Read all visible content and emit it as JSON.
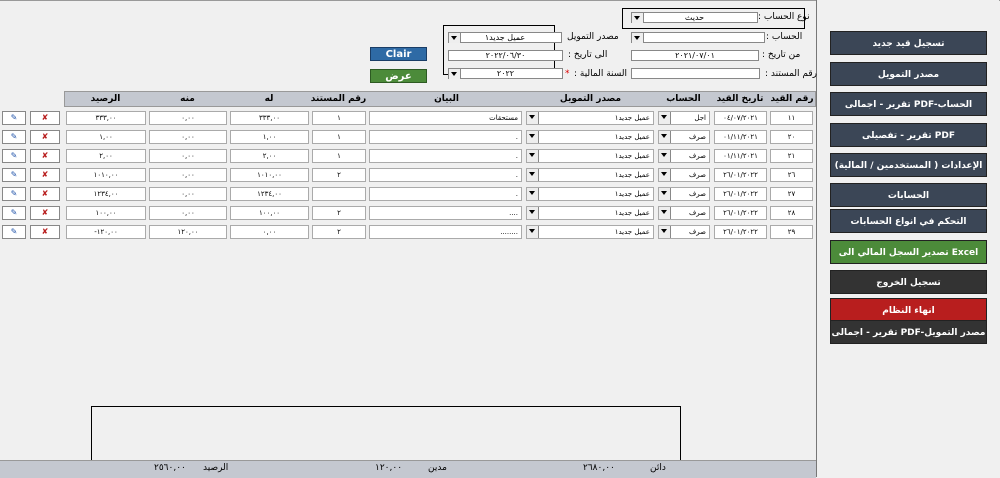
{
  "sidebar": {
    "items": [
      {
        "label": "تسجيل قيد جديد",
        "style": "normal"
      },
      {
        "label": "مصدر التمويل",
        "style": "normal"
      },
      {
        "label": "تقرير - اجمالى PDF-الحساب",
        "style": "normal"
      },
      {
        "label": "تقرير - تفصيلى PDF",
        "style": "normal"
      },
      {
        "label": "الإعدادات ( المستخدمين / المالية)",
        "style": "normal"
      },
      {
        "label": "الحسابات",
        "style": "normal"
      },
      {
        "label": "التحكم في انواع الحسابات",
        "style": "normal"
      },
      {
        "label": "تصدير السجل المالي الى Excel",
        "style": "green"
      },
      {
        "label": "تسجيل الخروج",
        "style": "dark"
      },
      {
        "label": "انهاء النظام",
        "style": "red"
      },
      {
        "label": "تقرير - اجمالى PDF-مصدر التمويل",
        "style": "dark"
      }
    ]
  },
  "form": {
    "account_type_label": "نوع الحساب :",
    "account_type_value": "حديث",
    "account_label": "الحساب :",
    "account_value": "",
    "funding_source_label": "مصدر التمويل",
    "funding_source_value": "عميل جديد١",
    "from_date_label": "من تاريخ :",
    "from_date_value": "٢٠٢١/٠٧/٠١",
    "to_date_label": "الى تاريخ :",
    "to_date_value": "٢٠٢٢/٠٦/٣٠",
    "doc_no_label": "رقم المستند :",
    "doc_no_value": "",
    "fiscal_year_label": "السنة المالية :",
    "fiscal_year_required": "*",
    "fiscal_year_value": "٢٠٢٢",
    "clear_button": "Clair",
    "show_button": "عرض"
  },
  "table": {
    "headers": {
      "entry_no": "رقم القيد",
      "entry_date": "تاريخ القيد",
      "account": "الحساب",
      "funding_source": "مصدر التمويل",
      "statement": "البيان",
      "doc_no": "رقم المستند",
      "credit": "له",
      "debit": "منه",
      "balance": "الرصيد"
    },
    "rows": [
      {
        "entry_no": "١١",
        "date": "٠٤/٠٧/٢٠٢١",
        "account": "اجل",
        "source": "عميل جديد١",
        "statement": "مستحقات",
        "doc_no": "١",
        "credit": "٣٣٣,٠٠",
        "debit": "٠,٠٠",
        "balance": "٣٣٣,٠٠"
      },
      {
        "entry_no": "٢٠",
        "date": "٠١/١١/٢٠٢١",
        "account": "صرف",
        "source": "عميل جديد١",
        "statement": ".",
        "doc_no": "١",
        "credit": "١,٠٠",
        "debit": "٠,٠٠",
        "balance": "١,٠٠"
      },
      {
        "entry_no": "٢١",
        "date": "٠١/١١/٢٠٢١",
        "account": "صرف",
        "source": "عميل جديد١",
        "statement": ".",
        "doc_no": "١",
        "credit": "٢,٠٠",
        "debit": "٠,٠٠",
        "balance": "٢,٠٠"
      },
      {
        "entry_no": "٢٦",
        "date": "٢٦/٠١/٢٠٢٢",
        "account": "صرف",
        "source": "عميل جديد١",
        "statement": ".",
        "doc_no": "٢",
        "credit": "١٠١٠,٠٠",
        "debit": "٠,٠٠",
        "balance": "١٠١٠,٠٠"
      },
      {
        "entry_no": "٢٧",
        "date": "٢٦/٠١/٢٠٢٢",
        "account": "صرف",
        "source": "عميل جديد١",
        "statement": ".",
        "doc_no": "",
        "credit": "١٢٣٤,٠٠",
        "debit": "٠,٠٠",
        "balance": "١٢٣٤,٠٠"
      },
      {
        "entry_no": "٢٨",
        "date": "٢٦/٠١/٢٠٢٢",
        "account": "صرف",
        "source": "عميل جديد١",
        "statement": "....",
        "doc_no": "٢",
        "credit": "١٠٠,٠٠",
        "debit": "٠,٠٠",
        "balance": "١٠٠,٠٠"
      },
      {
        "entry_no": "٢٩",
        "date": "٢٦/٠١/٢٠٢٢",
        "account": "صرف",
        "source": "عميل جديد١",
        "statement": "........",
        "doc_no": "٢",
        "credit": "٠,٠٠",
        "debit": "١٢٠,٠٠",
        "balance": "-١٢٠,٠٠"
      }
    ]
  },
  "footer": {
    "credit_label": "دائن",
    "credit_value": "٢٦٨٠,٠٠",
    "debit_label": "مدين",
    "debit_value": "١٢٠,٠٠",
    "balance_label": "الرصيد",
    "balance_value": "٢٥٦٠,٠٠"
  },
  "colors": {
    "sidebar_button": "#3b4656",
    "green_button": "#4c8b3a",
    "red_button": "#b81e1e",
    "clear_button": "#2e6aa5",
    "header_bg": "#c4c8d0"
  }
}
